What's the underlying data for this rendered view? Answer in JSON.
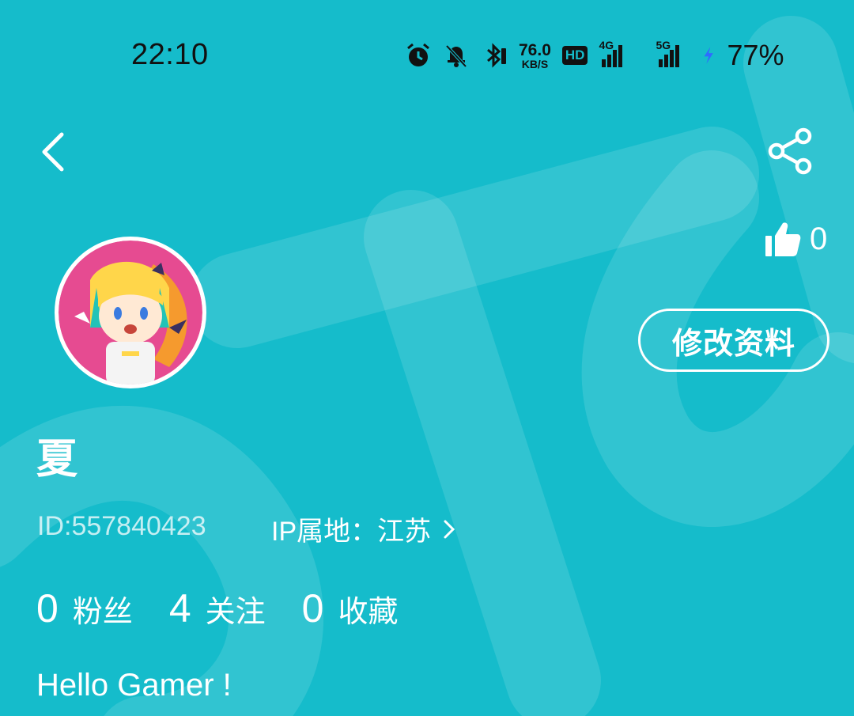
{
  "status_bar": {
    "time": "22:10",
    "net_speed_value": "76.0",
    "net_speed_unit": "KB/S",
    "hd_label": "HD",
    "signal_1_label": "4G",
    "signal_2_label": "5G",
    "battery_percent": "77%",
    "icons": [
      "alarm-icon",
      "mute-bell-icon",
      "bluetooth-icon",
      "charging-icon"
    ]
  },
  "header": {
    "back_icon": "chevron-left-icon",
    "share_icon": "share-icon"
  },
  "profile": {
    "likes_count": "0",
    "edit_button_label": "修改资料",
    "username": "夏",
    "id_text": "ID:557840423",
    "ip_label": "IP属地：江苏",
    "stats": [
      {
        "count": "0",
        "label": "粉丝"
      },
      {
        "count": "4",
        "label": "关注"
      },
      {
        "count": "0",
        "label": "收藏"
      }
    ],
    "bio": "Hello Gamer !"
  },
  "colors": {
    "background": "#15bccb",
    "text": "#ffffff",
    "status_text": "#111111",
    "charging_bolt": "#2f6bff"
  }
}
